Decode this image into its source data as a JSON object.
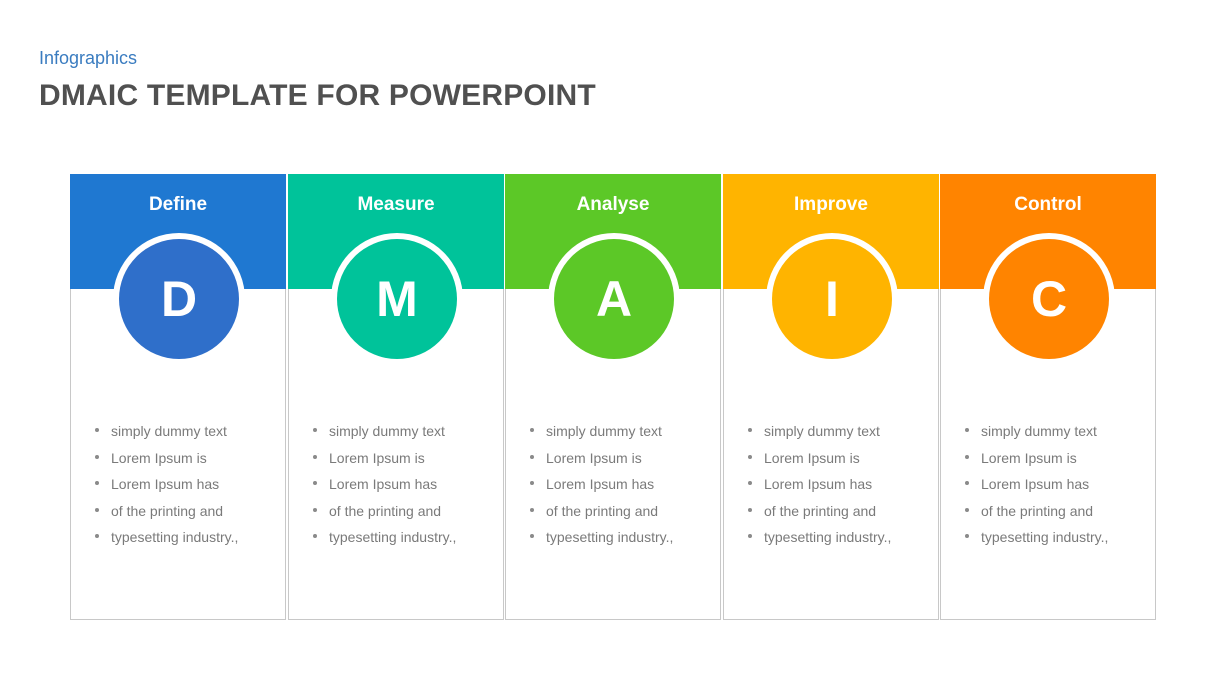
{
  "header": {
    "subtitle": "Infographics",
    "title": "DMAIC TEMPLATE FOR POWERPOINT"
  },
  "stages": [
    {
      "label": "Define",
      "letter": "D",
      "head_color": "#1f78d1",
      "circle_color": "#2f6fca",
      "bullets": [
        "simply dummy text",
        "Lorem Ipsum is",
        "Lorem Ipsum has",
        "of the printing and",
        "typesetting industry.,"
      ]
    },
    {
      "label": "Measure",
      "letter": "M",
      "head_color": "#00c39a",
      "circle_color": "#00c39a",
      "bullets": [
        "simply dummy text",
        "Lorem Ipsum is",
        "Lorem Ipsum has",
        "of the printing and",
        "typesetting industry.,"
      ]
    },
    {
      "label": "Analyse",
      "letter": "A",
      "head_color": "#5cc827",
      "circle_color": "#5cc827",
      "bullets": [
        "simply dummy text",
        "Lorem Ipsum is",
        "Lorem Ipsum has",
        "of the printing and",
        "typesetting industry.,"
      ]
    },
    {
      "label": "Improve",
      "letter": "I",
      "head_color": "#ffb400",
      "circle_color": "#ffb400",
      "bullets": [
        "simply dummy text",
        "Lorem Ipsum is",
        "Lorem Ipsum has",
        "of the printing and",
        "typesetting industry.,"
      ]
    },
    {
      "label": "Control",
      "letter": "C",
      "head_color": "#ff8400",
      "circle_color": "#ff8400",
      "bullets": [
        "simply dummy text",
        "Lorem Ipsum is",
        "Lorem Ipsum has",
        "of the printing and",
        "typesetting industry.,"
      ]
    }
  ]
}
